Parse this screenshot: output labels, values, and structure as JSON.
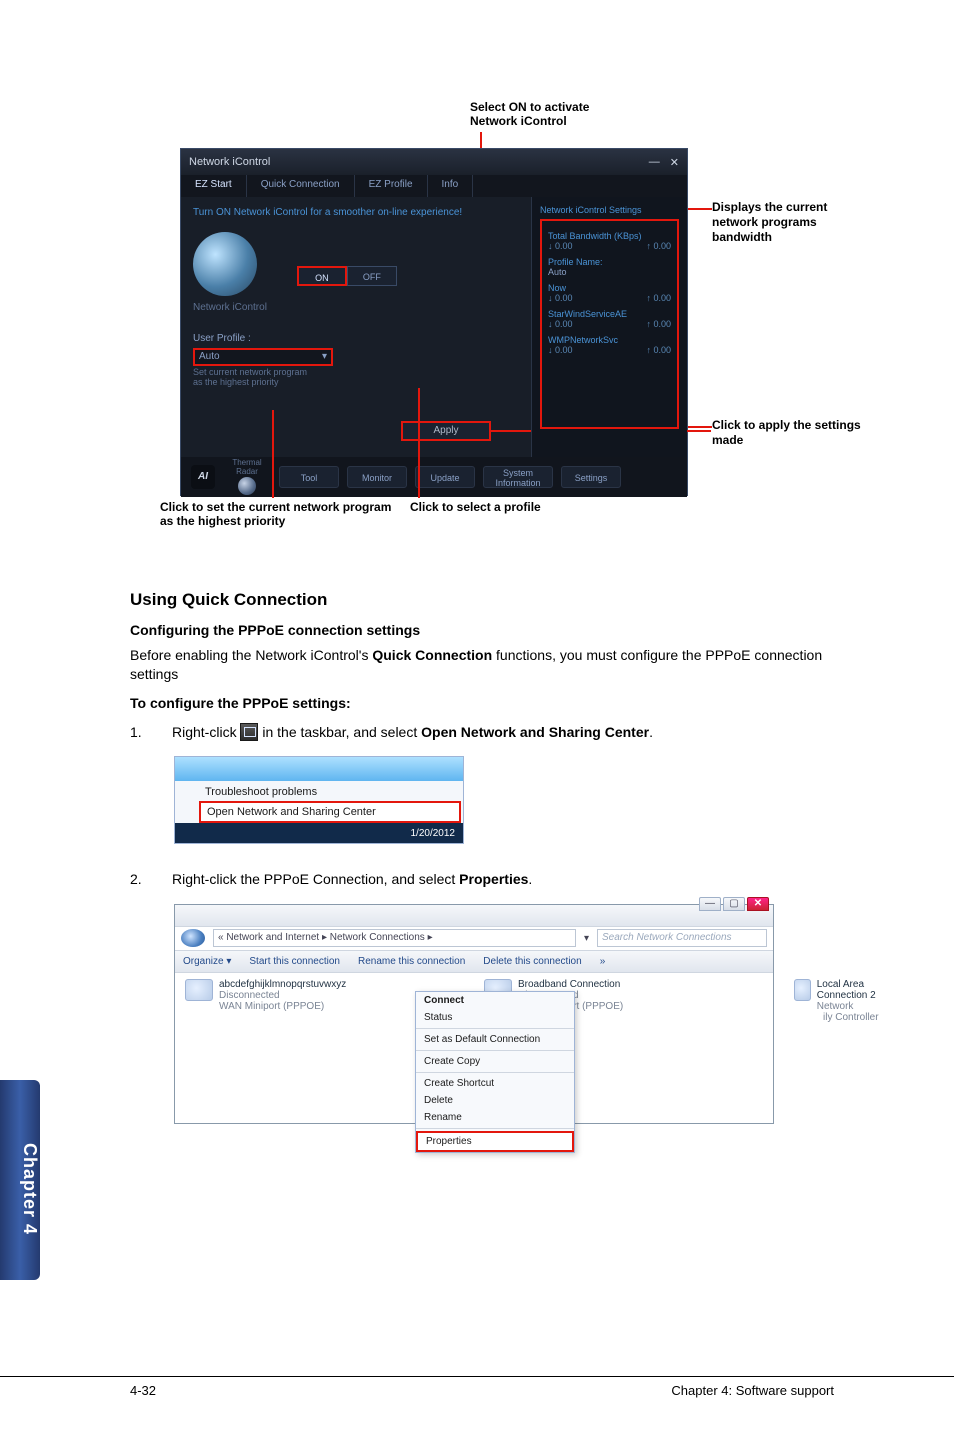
{
  "callouts": {
    "top": "Select ON to activate\nNetwork iControl",
    "right1": "Displays the current network programs bandwidth",
    "right2": "Click to apply the settings made",
    "bottom_left": "Click to set the current network program as the highest priority",
    "bottom_mid": "Click to select a profile"
  },
  "appwin": {
    "title": "Network iControl",
    "close": "✕",
    "min": "—",
    "tabs": [
      "EZ Start",
      "Quick Connection",
      "EZ Profile",
      "Info"
    ],
    "msg": "Turn ON Network iControl for a smoother on-line experience!",
    "on": "ON",
    "off": "OFF",
    "leftlabel": "Network iControl",
    "userprofile_lbl": "User Profile :",
    "userprofile_val": "Auto",
    "userprofile_hint1": "Set current network program",
    "userprofile_hint2": "as the highest priority",
    "apply": "Apply",
    "right_head": "Network iControl Settings",
    "right_bw_t": "Total Bandwidth (KBps)",
    "right_dn1": "↓ 0.00",
    "right_up1": "↑ 0.00",
    "right_profname_t": "Profile Name:",
    "right_profname_v": "Auto",
    "right_now": "Now",
    "right_dn2": "↓ 0.00",
    "right_up2": "↑ 0.00",
    "right_svc1": "StarWindServiceAE",
    "right_dn3": "↓ 0.00",
    "right_up3": "↑ 0.00",
    "right_svc2": "WMPNetworkSvc",
    "right_dn4": "↓ 0.00",
    "right_up4": "↑ 0.00",
    "bb_thermal": "Thermal Radar",
    "bb_tool": "Tool",
    "bb_monitor": "Monitor",
    "bb_update": "Update",
    "bb_sys": "System Information",
    "bb_settings": "Settings",
    "logo": "AI"
  },
  "text": {
    "h2": "Using Quick Connection",
    "h3": "Configuring the PPPoE connection settings",
    "para1a": "Before enabling the Network iControl's ",
    "para1b": "Quick Connection",
    "para1c": " functions, you must configure the PPPoE connection settings",
    "para2": "To configure the PPPoE settings",
    "step1_num": "1.",
    "step1a": "Right-click ",
    "step1b": " in the taskbar, and select ",
    "step1c": "Open Network and Sharing Center",
    "step1d": ".",
    "step2_num": "2.",
    "step2a": "Right-click the PPPoE Connection, and select ",
    "step2b": "Properties",
    "step2c": "."
  },
  "tray": {
    "item1": "Troubleshoot problems",
    "item2": "Open Network and Sharing Center",
    "time": "1/20/2012"
  },
  "expl": {
    "crumbs": "« Network and Internet  ▸  Network Connections  ▸",
    "search": "Search Network Connections",
    "organize": "Organize ▾",
    "t1": "Start this connection",
    "t2": "Rename this connection",
    "t3": "Delete this connection",
    "t4": "»",
    "conn1_name": "abcdefghijklmnopqrstuvwxyz",
    "conn1_state": "Disconnected",
    "conn1_dev": "WAN Miniport (PPPOE)",
    "conn2_name": "Broadband Connection",
    "conn2_state": "Disconnected",
    "conn2_dev": "WAN Miniport (PPPOE)",
    "conn3_name": "Local Area Connection 2",
    "conn3_state": "Network",
    "conn3_dev": "ily Controller",
    "ctx": [
      "Connect",
      "Status",
      "Set as Default Connection",
      "Create Copy",
      "Create Shortcut",
      "Delete",
      "Rename",
      "Properties"
    ]
  },
  "footer": {
    "left": "4-32",
    "right": "Chapter 4: Software support"
  },
  "chapter_tab": "Chapter 4"
}
